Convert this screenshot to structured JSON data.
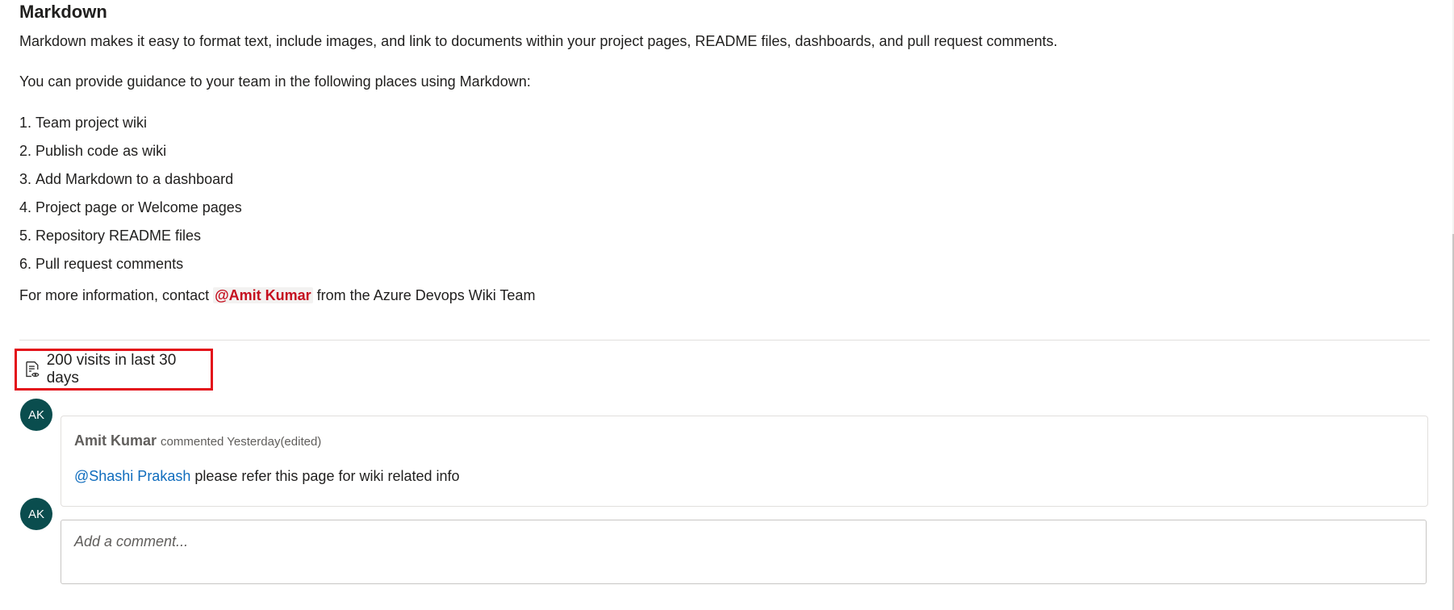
{
  "article": {
    "heading": "Markdown",
    "intro": "Markdown makes it easy to format text, include images, and link to documents within your project pages, README files, dashboards, and pull request comments.",
    "guidance": "You can provide guidance to your team in the following places using Markdown:",
    "list": [
      "Team project wiki",
      "Publish code as wiki",
      "Add Markdown to a dashboard",
      "Project page or Welcome pages",
      "Repository README files",
      "Pull request comments"
    ],
    "contact_prefix": "For more information, contact ",
    "contact_mention": "@Amit Kumar",
    "contact_suffix": " from the Azure Devops Wiki Team"
  },
  "stats": {
    "visits_text": "200 visits in last 30 days",
    "icon": "page-visits-icon"
  },
  "comments": [
    {
      "initials": "AK",
      "author": "Amit Kumar",
      "timestamp": "commented Yesterday(edited)",
      "mention": "@Shashi Prakash",
      "text": " please refer this page for wiki related info"
    }
  ],
  "new_comment": {
    "initials": "AK",
    "placeholder": "Add a comment..."
  },
  "colors": {
    "avatar_bg": "#0a4d4e",
    "highlight_border": "#e3101a",
    "mention_strong": "#c50f1f",
    "mention_link": "#0f6cbd"
  }
}
